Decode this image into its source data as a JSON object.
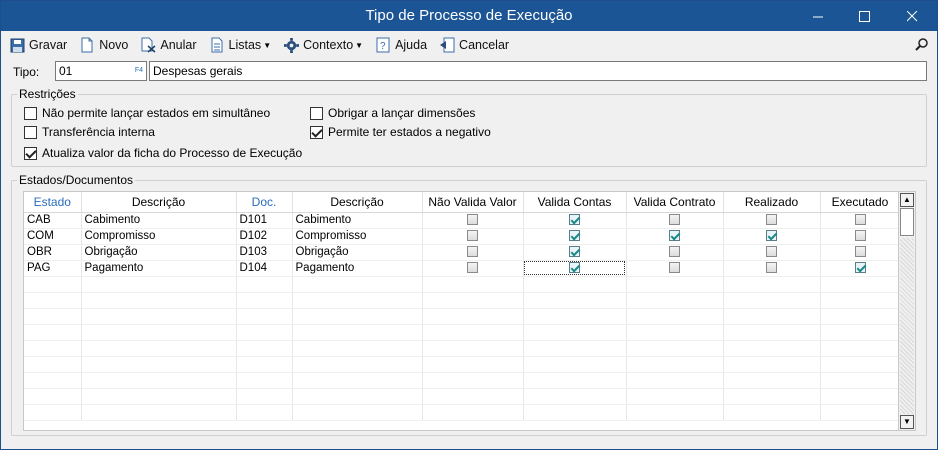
{
  "window": {
    "title": "Tipo de Processo de Execução"
  },
  "toolbar": {
    "items": [
      {
        "label": "Gravar",
        "icon": "save-icon"
      },
      {
        "label": "Novo",
        "icon": "new-document-icon"
      },
      {
        "label": "Anular",
        "icon": "cancel-document-icon"
      },
      {
        "label": "Listas",
        "icon": "list-icon",
        "dropdown": true
      },
      {
        "label": "Contexto",
        "icon": "gear-icon",
        "dropdown": true
      },
      {
        "label": "Ajuda",
        "icon": "help-icon"
      },
      {
        "label": "Cancelar",
        "icon": "exit-icon"
      }
    ]
  },
  "tipo": {
    "label": "Tipo:",
    "code": "01",
    "description": "Despesas gerais"
  },
  "restricoes": {
    "legend": "Restrições",
    "options": [
      {
        "label": "Não permite lançar estados em simultâneo",
        "checked": false
      },
      {
        "label": "Transferência interna",
        "checked": false
      },
      {
        "label": "Atualiza valor da ficha do Processo de Execução",
        "checked": true
      },
      {
        "label": "Obrigar a lançar dimensões",
        "checked": false
      },
      {
        "label": "Permite ter estados a negativo",
        "checked": true
      }
    ]
  },
  "estados": {
    "legend": "Estados/Documentos",
    "columns": [
      "Estado",
      "Descrição",
      "Doc.",
      "Descrição",
      "Não Valida Valor",
      "Valida Contas",
      "Valida Contrato",
      "Realizado",
      "Executado"
    ],
    "rows": [
      {
        "estado": "CAB",
        "descricao": "Cabimento",
        "doc": "D101",
        "doc_descricao": "Cabimento",
        "flags": [
          false,
          true,
          false,
          false,
          false
        ]
      },
      {
        "estado": "COM",
        "descricao": "Compromisso",
        "doc": "D102",
        "doc_descricao": "Compromisso",
        "flags": [
          false,
          true,
          true,
          true,
          false
        ]
      },
      {
        "estado": "OBR",
        "descricao": "Obrigação",
        "doc": "D103",
        "doc_descricao": "Obrigação",
        "flags": [
          false,
          true,
          false,
          false,
          false
        ]
      },
      {
        "estado": "PAG",
        "descricao": "Pagamento",
        "doc": "D104",
        "doc_descricao": "Pagamento",
        "flags": [
          false,
          true,
          false,
          false,
          true
        ]
      }
    ]
  },
  "colors": {
    "titlebar": "#1c5596",
    "link_header": "#2a6ebb",
    "check_accent": "#1a8a86"
  }
}
